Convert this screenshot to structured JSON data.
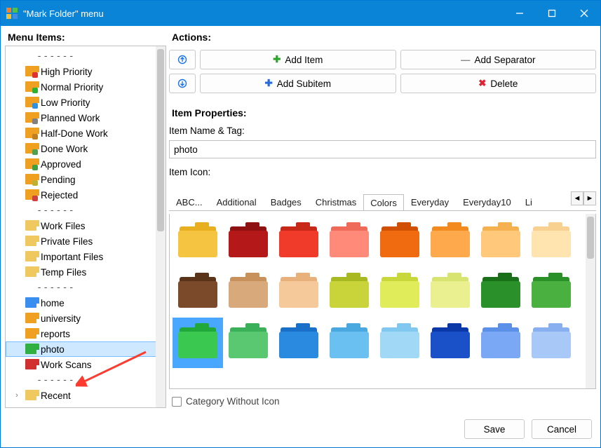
{
  "window": {
    "title": "\"Mark Folder\" menu"
  },
  "left": {
    "label": "Menu Items:",
    "items": [
      {
        "type": "sep",
        "text": "------"
      },
      {
        "text": "High Priority",
        "color": "#f0a020",
        "badge": "#e03030"
      },
      {
        "text": "Normal Priority",
        "color": "#f0a020",
        "badge": "#30b030"
      },
      {
        "text": "Low Priority",
        "color": "#f0a020",
        "badge": "#3090e0"
      },
      {
        "text": "Planned Work",
        "color": "#f0a020",
        "badge": "#808080"
      },
      {
        "text": "Half-Done Work",
        "color": "#f0a020",
        "badge": "#c08020"
      },
      {
        "text": "Done Work",
        "color": "#f0a020",
        "badge": "#50a050"
      },
      {
        "text": "Approved",
        "color": "#f0a020",
        "badge": "#40a040"
      },
      {
        "text": "Pending",
        "color": "#f0a020",
        "badge": "#c0b030"
      },
      {
        "text": "Rejected",
        "color": "#f0a020",
        "badge": "#d04040"
      },
      {
        "type": "sep",
        "text": "------"
      },
      {
        "text": "Work Files",
        "color": "#f0c860"
      },
      {
        "text": "Private Files",
        "color": "#f0c860"
      },
      {
        "text": "Important Files",
        "color": "#f0c860"
      },
      {
        "text": "Temp Files",
        "color": "#f0c860"
      },
      {
        "type": "sep",
        "text": "------"
      },
      {
        "text": "home",
        "color": "#3a8ef0"
      },
      {
        "text": "university",
        "color": "#f0a020"
      },
      {
        "text": "reports",
        "color": "#f0a020"
      },
      {
        "text": "photo",
        "color": "#30b040",
        "selected": true
      },
      {
        "text": "Work Scans",
        "color": "#d03030"
      },
      {
        "type": "sep",
        "text": "------"
      },
      {
        "text": "Recent",
        "color": "#f0c860",
        "expander": true
      }
    ]
  },
  "actions": {
    "label": "Actions:",
    "up_icon": "arrow-up",
    "down_icon": "arrow-down",
    "add_item": "Add Item",
    "add_subitem": "Add Subitem",
    "add_separator": "Add Separator",
    "delete": "Delete"
  },
  "props": {
    "label": "Item Properties:",
    "name_tag_label": "Item Name & Tag:",
    "name_value": "photo",
    "icon_label": "Item Icon:"
  },
  "tabs": {
    "list": [
      "ABC...",
      "Additional",
      "Badges",
      "Christmas",
      "Colors",
      "Everyday",
      "Everyday10",
      "Li"
    ],
    "active": "Colors"
  },
  "icons": {
    "selected_index": 16,
    "colors": [
      {
        "front": "#f5c542",
        "back": "#e8b020"
      },
      {
        "front": "#b51818",
        "back": "#8f1010"
      },
      {
        "front": "#f03a2a",
        "back": "#c82818"
      },
      {
        "front": "#ff8a7a",
        "back": "#f06a5a"
      },
      {
        "front": "#f06a10",
        "back": "#d05000"
      },
      {
        "front": "#ffa94d",
        "back": "#f28a20"
      },
      {
        "front": "#ffc87a",
        "back": "#f5b050"
      },
      {
        "front": "#ffe4b0",
        "back": "#f8d090"
      },
      {
        "front": "#7a4a2a",
        "back": "#5a3418"
      },
      {
        "front": "#d8a97a",
        "back": "#c8905a"
      },
      {
        "front": "#f5c99a",
        "back": "#e8b07a"
      },
      {
        "front": "#c8d43a",
        "back": "#a8b820"
      },
      {
        "front": "#e0ec5a",
        "back": "#c8d83a"
      },
      {
        "front": "#eaf090",
        "back": "#d8e470"
      },
      {
        "front": "#2a902a",
        "back": "#1a7018"
      },
      {
        "front": "#4ab040",
        "back": "#2a9028"
      },
      {
        "front": "#3ac850",
        "back": "#20a838"
      },
      {
        "front": "#5ac870",
        "back": "#3ab058"
      },
      {
        "front": "#2a8ae0",
        "back": "#1870c8"
      },
      {
        "front": "#6ac0f0",
        "back": "#4aa8e0"
      },
      {
        "front": "#a0d8f5",
        "back": "#80c8f0"
      },
      {
        "front": "#1a50c8",
        "back": "#0a38a8"
      },
      {
        "front": "#7aa8f5",
        "back": "#5a90e8"
      },
      {
        "front": "#a8c8f8",
        "back": "#88b0f0"
      }
    ]
  },
  "category_checkbox": {
    "label": "Category Without Icon",
    "checked": false
  },
  "buttons": {
    "save": "Save",
    "cancel": "Cancel"
  }
}
